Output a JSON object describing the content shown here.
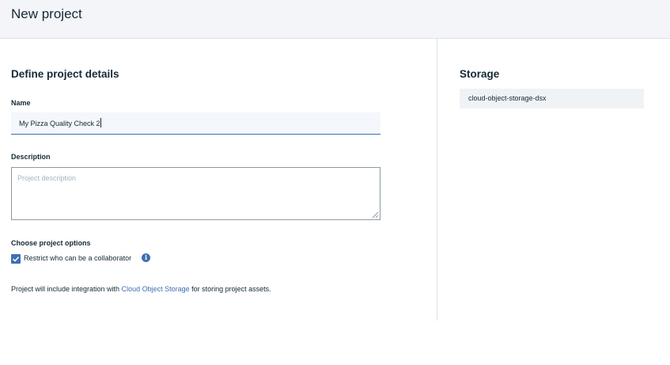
{
  "header": {
    "title": "New project"
  },
  "details": {
    "section_title": "Define project details",
    "name": {
      "label": "Name",
      "value": "My Pizza Quality Check 2"
    },
    "description": {
      "label": "Description",
      "placeholder": "Project description",
      "value": ""
    },
    "options": {
      "label": "Choose project options",
      "restrict_collaborator": {
        "label": "Restrict who can be a collaborator",
        "checked": true,
        "info_icon": "info-icon"
      }
    },
    "integration": {
      "prefix": "Project will include integration with ",
      "link_text": "Cloud Object Storage",
      "suffix": " for storing project assets."
    }
  },
  "storage": {
    "section_title": "Storage",
    "instance": "cloud-object-storage-dsx"
  },
  "colors": {
    "accent": "#3d70b2",
    "header_bg": "#f3f5f9",
    "text": "#152935"
  }
}
